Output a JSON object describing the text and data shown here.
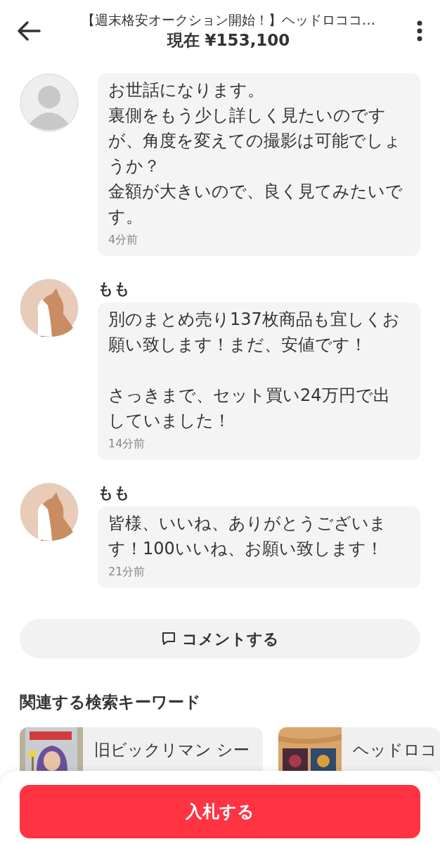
{
  "header": {
    "title": "【週末格安オークション開始！】ヘッドロココ…",
    "price": "現在 ¥153,100"
  },
  "comments": [
    {
      "blocks": [
        {
          "lines": [
            "お世話になります。",
            "裏側をもう少し詳しく見たいのですが、角度を変えての撮影は可能でしょうか？",
            "金額が大きいので、良く見てみたいです。"
          ]
        }
      ],
      "time": "4分前"
    },
    {
      "name": "もも",
      "blocks": [
        {
          "lines": [
            "別のまとめ売り137枚商品も宜しくお願い致します！まだ、安値です！"
          ]
        },
        {
          "lines": [
            "さっきまで、セット買い24万円で出していました！"
          ]
        }
      ],
      "time": "14分前"
    },
    {
      "name": "もも",
      "blocks": [
        {
          "lines": [
            "皆様、いいね、ありがとうございます！100いいね、お願い致します！"
          ]
        }
      ],
      "time": "21分前"
    }
  ],
  "comment_button": "コメントする",
  "keywords": {
    "heading": "関連する検索キーワード",
    "items": [
      {
        "title": "旧ビックリマン シー"
      },
      {
        "title": "ヘッドロコ"
      }
    ]
  },
  "bid_button": "入札する"
}
